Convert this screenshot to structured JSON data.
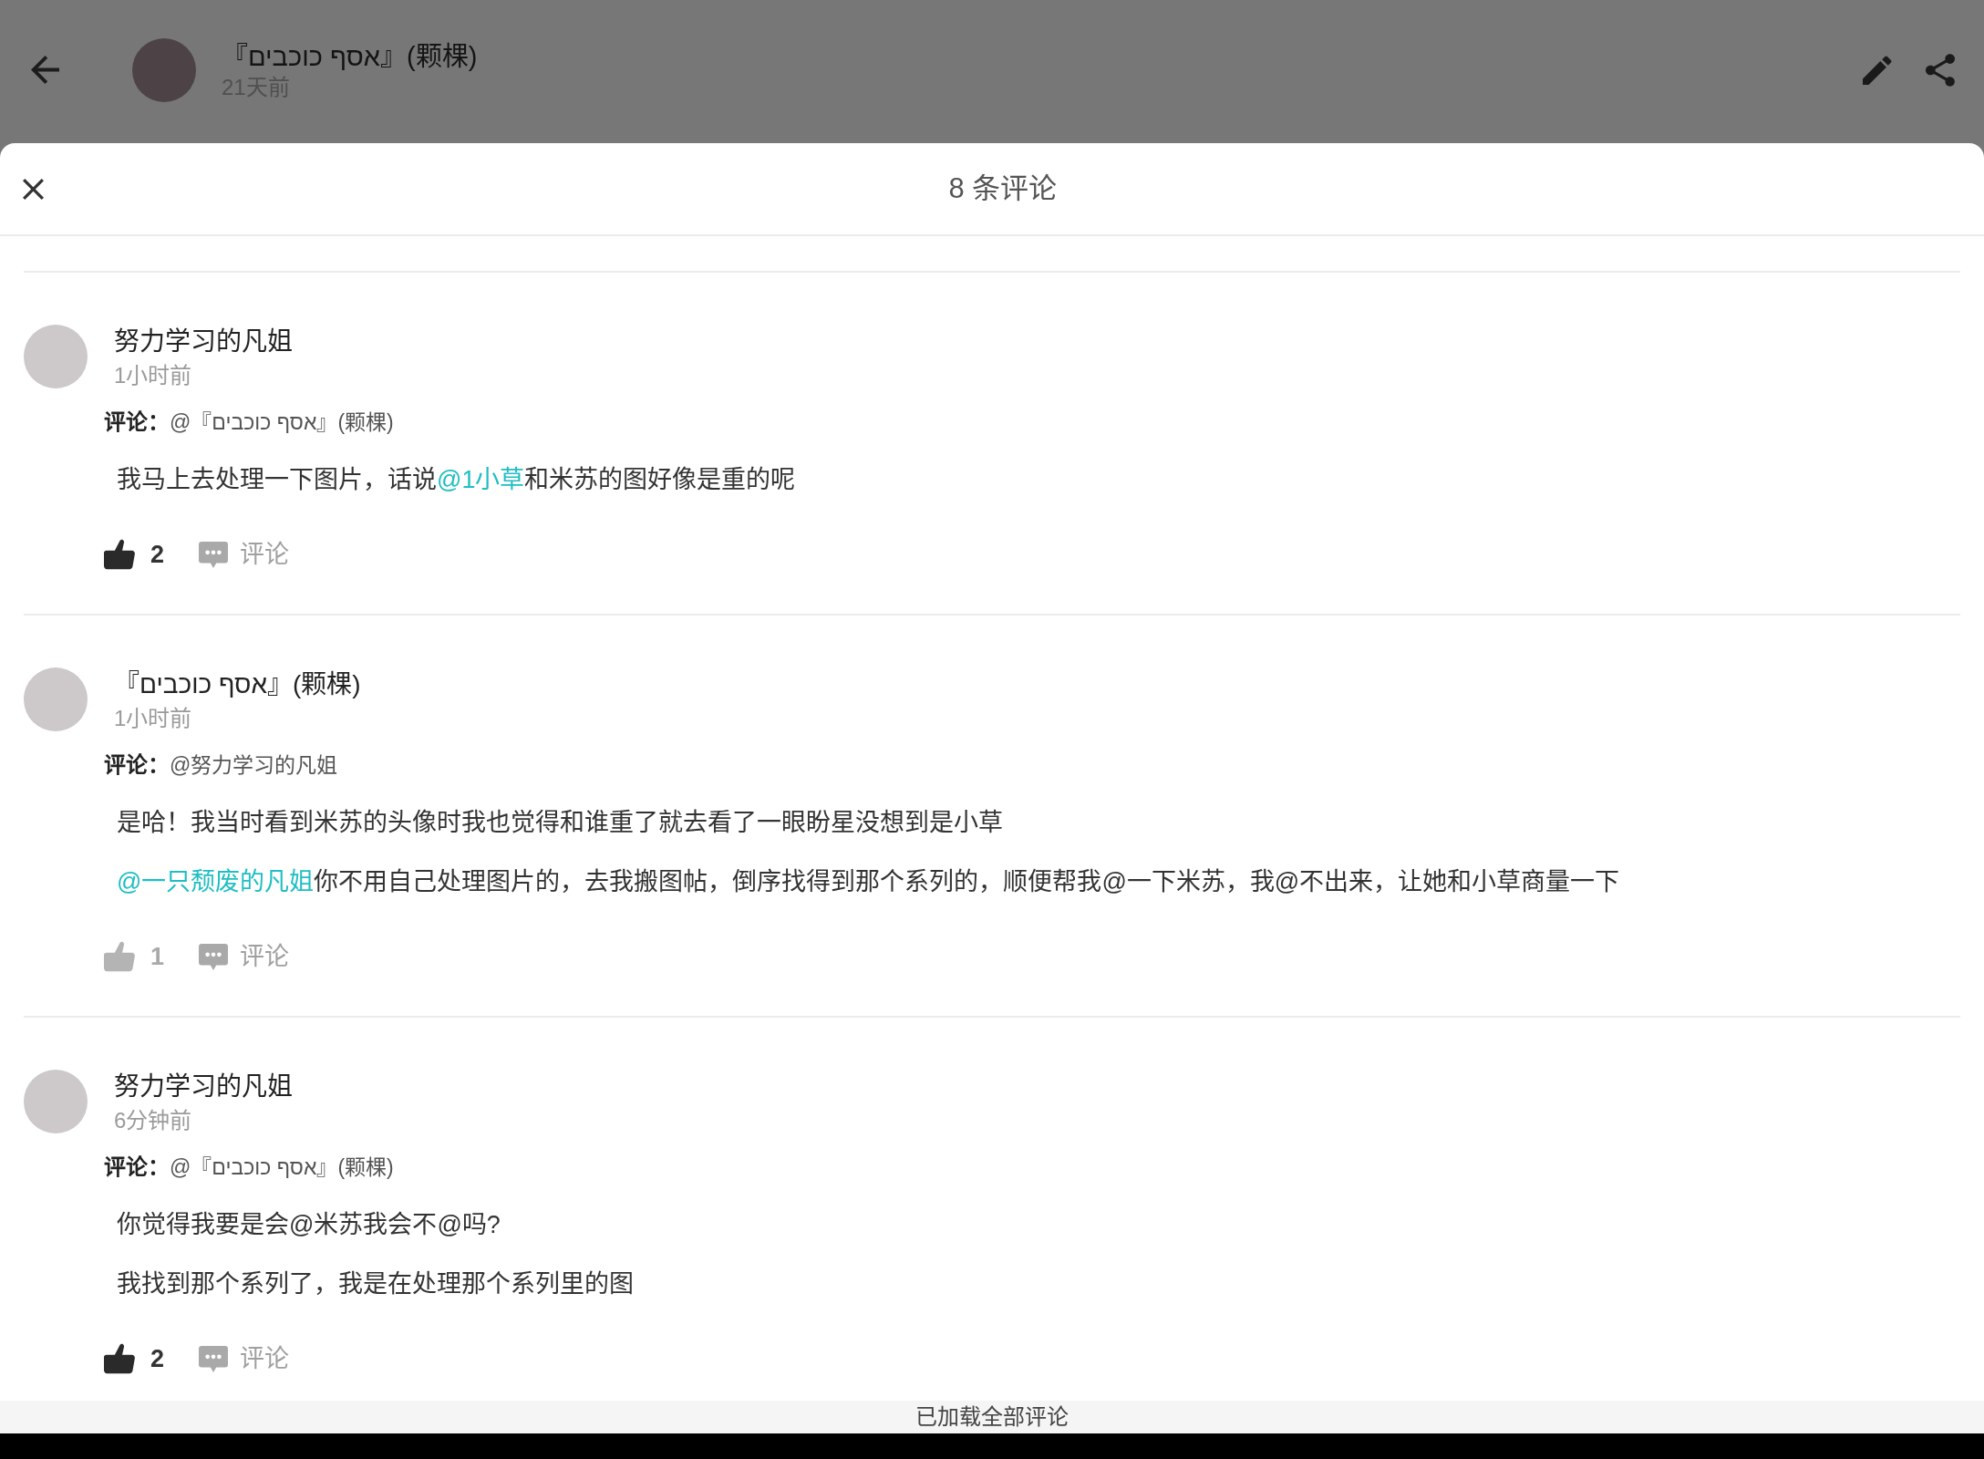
{
  "header": {
    "author": "『אסף כוכבים』(颗棵)",
    "time": "21天前"
  },
  "sheet": {
    "title": "8 条评论"
  },
  "comments": [
    {
      "author": "努力学习的凡姐",
      "time": "1小时前",
      "reply_label": "评论：",
      "reply_to": "@『אסף כוכבים』(颗棵)",
      "paragraphs": [
        [
          {
            "kind": "text",
            "text": "我马上去处理一下图片，话说"
          },
          {
            "kind": "mention",
            "text": "@1小草"
          },
          {
            "kind": "text",
            "text": "和米苏的图好像是重的呢"
          }
        ]
      ],
      "liked": true,
      "likes": "2",
      "reply_button": "评论"
    },
    {
      "author": "『אסף כוכבים』(颗棵)",
      "time": "1小时前",
      "reply_label": "评论：",
      "reply_to": "@努力学习的凡姐",
      "paragraphs": [
        [
          {
            "kind": "text",
            "text": "是哈！我当时看到米苏的头像时我也觉得和谁重了就去看了一眼盼星没想到是小草"
          }
        ],
        [
          {
            "kind": "mention",
            "text": "@一只颓废的凡姐"
          },
          {
            "kind": "text",
            "text": "你不用自己处理图片的，去我搬图帖，倒序找得到那个系列的，顺便帮我@一下米苏，我@不出来，让她和小草商量一下"
          }
        ]
      ],
      "liked": false,
      "likes": "1",
      "reply_button": "评论"
    },
    {
      "author": "努力学习的凡姐",
      "time": "6分钟前",
      "reply_label": "评论：",
      "reply_to": "@『אסף כוכבים』(颗棵)",
      "paragraphs": [
        [
          {
            "kind": "text",
            "text": "你觉得我要是会@米苏我会不@吗?"
          }
        ],
        [
          {
            "kind": "text",
            "text": "我找到那个系列了，我是在处理那个系列里的图"
          }
        ]
      ],
      "liked": true,
      "likes": "2",
      "reply_button": "评论"
    }
  ],
  "footer": "已加载全部评论"
}
